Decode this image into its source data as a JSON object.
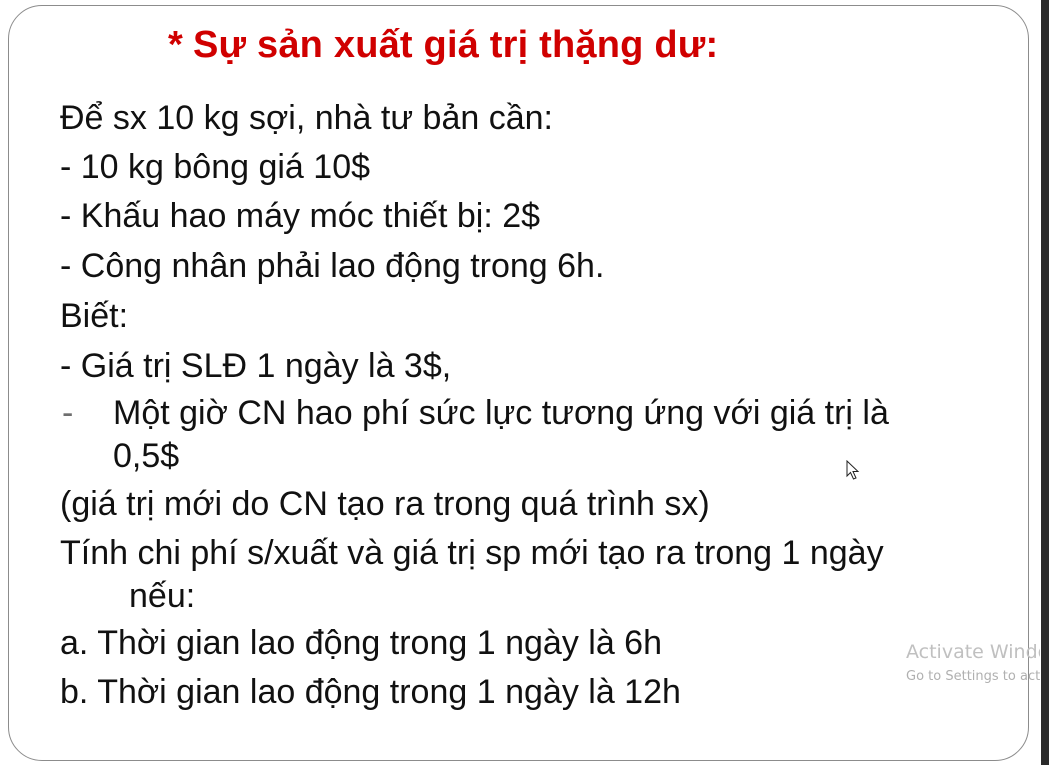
{
  "slide": {
    "title_star": "*",
    "title_text": "Sự sản xuất giá trị thặng dư:",
    "lines": [
      "Để sx 10 kg sợi, nhà tư bản cần:",
      "- 10 kg bông giá 10$",
      "- Khấu hao máy móc thiết bị: 2$",
      "- Công nhân phải lao động trong 6h.",
      "Biết:",
      "- Giá trị SLĐ 1 ngày là 3$,",
      "-",
      "Một giờ CN hao phí sức lực tương ứng với giá trị là",
      "0,5$",
      "(giá trị mới do CN tạo ra trong quá trình sx)",
      "Tính chi phí s/xuất và giá trị sp mới tạo ra trong 1 ngày",
      "nếu:",
      "a. Thời gian lao động trong 1 ngày là 6h",
      "b. Thời gian lao động trong 1 ngày là 12h"
    ]
  },
  "watermark": {
    "line1": "Activate Windows",
    "line2": "Go to Settings to activate Windows."
  },
  "icons": {
    "cursor": "mouse-pointer-icon"
  }
}
